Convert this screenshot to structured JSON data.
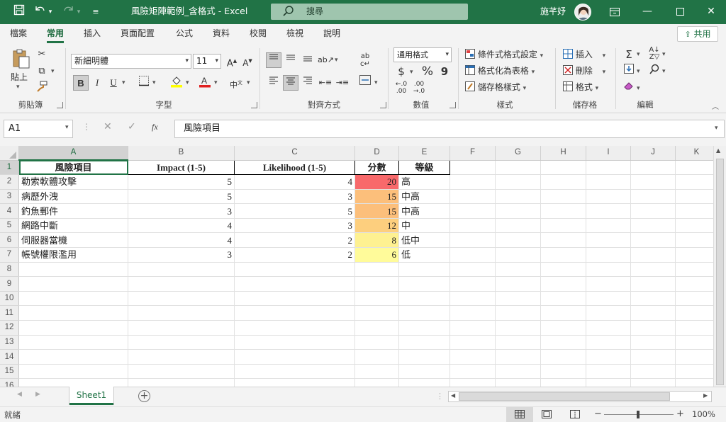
{
  "window": {
    "title": "風險矩陣範例_含格式 - Excel",
    "search_placeholder": "搜尋",
    "user_name": "施芊妤",
    "accent_color": "#217346"
  },
  "ribbon_tabs": [
    "檔案",
    "常用",
    "插入",
    "頁面配置",
    "公式",
    "資料",
    "校閱",
    "檢視",
    "說明"
  ],
  "active_tab": "常用",
  "share_label": "共用",
  "ribbon": {
    "clipboard": {
      "paste": "貼上",
      "label": "剪貼簿"
    },
    "font": {
      "name": "新細明體",
      "size": "11",
      "bold": "B",
      "italic": "I",
      "underline": "U",
      "label": "字型"
    },
    "alignment": {
      "label": "對齊方式"
    },
    "number": {
      "format": "通用格式",
      "currency": "$",
      "percent": "%",
      "comma": "9",
      "label": "數值"
    },
    "styles": {
      "conditional": "條件式格式設定",
      "as_table": "格式化為表格",
      "cell_styles": "儲存格樣式",
      "label": "樣式"
    },
    "cells": {
      "insert": "插入",
      "delete": "刪除",
      "format": "格式",
      "label": "儲存格"
    },
    "editing": {
      "label": "編輯"
    }
  },
  "formula_bar": {
    "name_box": "A1",
    "fx": "fx",
    "content": "風險項目"
  },
  "columns": [
    "A",
    "B",
    "C",
    "D",
    "E",
    "F",
    "G",
    "H",
    "I",
    "J",
    "K"
  ],
  "row_numbers": [
    "1",
    "2",
    "3",
    "4",
    "5",
    "6",
    "7",
    "8",
    "9",
    "10",
    "11",
    "12",
    "13",
    "14",
    "15",
    "16"
  ],
  "table": {
    "headers": [
      "風險項目",
      "Impact (1-5)",
      "Likelihood (1-5)",
      "分數",
      "等級"
    ],
    "rows": [
      {
        "item": "勒索軟體攻擊",
        "impact": "5",
        "likelihood": "4",
        "score": "20",
        "level": "高",
        "color": "#f8696b"
      },
      {
        "item": "病歷外洩",
        "impact": "5",
        "likelihood": "3",
        "score": "15",
        "level": "中高",
        "color": "#fcbf7b"
      },
      {
        "item": "釣魚郵件",
        "impact": "3",
        "likelihood": "5",
        "score": "15",
        "level": "中高",
        "color": "#fcbf7b"
      },
      {
        "item": "網路中斷",
        "impact": "4",
        "likelihood": "3",
        "score": "12",
        "level": "中",
        "color": "#fdcf7e"
      },
      {
        "item": "伺服器當機",
        "impact": "4",
        "likelihood": "2",
        "score": "8",
        "level": "低中",
        "color": "#fef191"
      },
      {
        "item": "帳號權限濫用",
        "impact": "3",
        "likelihood": "2",
        "score": "6",
        "level": "低",
        "color": "#fffb9a"
      }
    ]
  },
  "sheet_tabs": [
    "Sheet1"
  ],
  "status": {
    "ready": "就緒",
    "zoom": "100%"
  }
}
